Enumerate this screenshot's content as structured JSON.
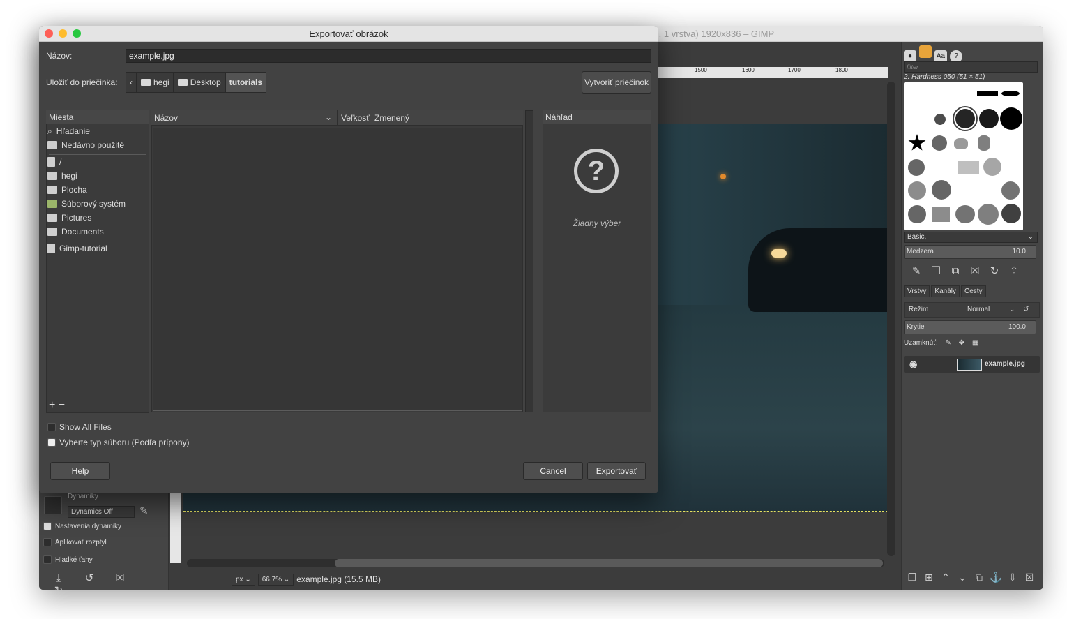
{
  "gimp": {
    "title": "B, 1 vrstva) 1920x836 – GIMP",
    "ruler_ticks": [
      "1500",
      "1600",
      "1700",
      "1800"
    ],
    "status": {
      "unit": "px",
      "zoom": "66.7%",
      "file_info": "example.jpg (15.5 MB)"
    }
  },
  "brushes": {
    "filter_placeholder": "filter",
    "current_brush": "2. Hardness 050 (51 × 51)",
    "preset": "Basic,",
    "spacing_label": "Medzera",
    "spacing_value": "10.0"
  },
  "layers": {
    "tabs": [
      "Vrstvy",
      "Kanály",
      "Cesty"
    ],
    "mode_label": "Režim",
    "mode_value": "Normal",
    "opacity_label": "Krytie",
    "opacity_value": "100.0",
    "lock_label": "Uzamknúť:",
    "items": [
      {
        "name": "example.jpg"
      }
    ]
  },
  "tool_options": {
    "dynamics_label": "Dynamiky",
    "dynamics_value": "Dynamics Off",
    "checkboxes": [
      "Nastavenia dynamiky",
      "Aplikovať rozptyl",
      "Hladké ťahy"
    ]
  },
  "dialog": {
    "title": "Exportovať obrázok",
    "name_label": "Názov:",
    "name_value": "example.jpg",
    "save_label": "Uložiť do priečinka:",
    "breadcrumbs": [
      "hegi",
      "Desktop",
      "tutorials"
    ],
    "create_folder": "Vytvoriť priečinok",
    "places_header": "Miesta",
    "places": [
      "Hľadanie",
      "Nedávno použité",
      "/",
      "hegi",
      "Plocha",
      "Súborový systém",
      "Pictures",
      "Documents",
      "Gimp-tutorial"
    ],
    "columns": {
      "name": "Názov",
      "size": "Veľkosť",
      "modified": "Zmenený"
    },
    "preview_header": "Náhľad",
    "no_selection": "Žiadny výber",
    "show_all": "Show All Files",
    "file_type": "Vyberte typ súboru (Podľa prípony)",
    "help": "Help",
    "cancel": "Cancel",
    "export": "Exportovať"
  },
  "colors": {
    "close": "#fe5f57",
    "minimize": "#febc2e",
    "zoom": "#28c840"
  }
}
